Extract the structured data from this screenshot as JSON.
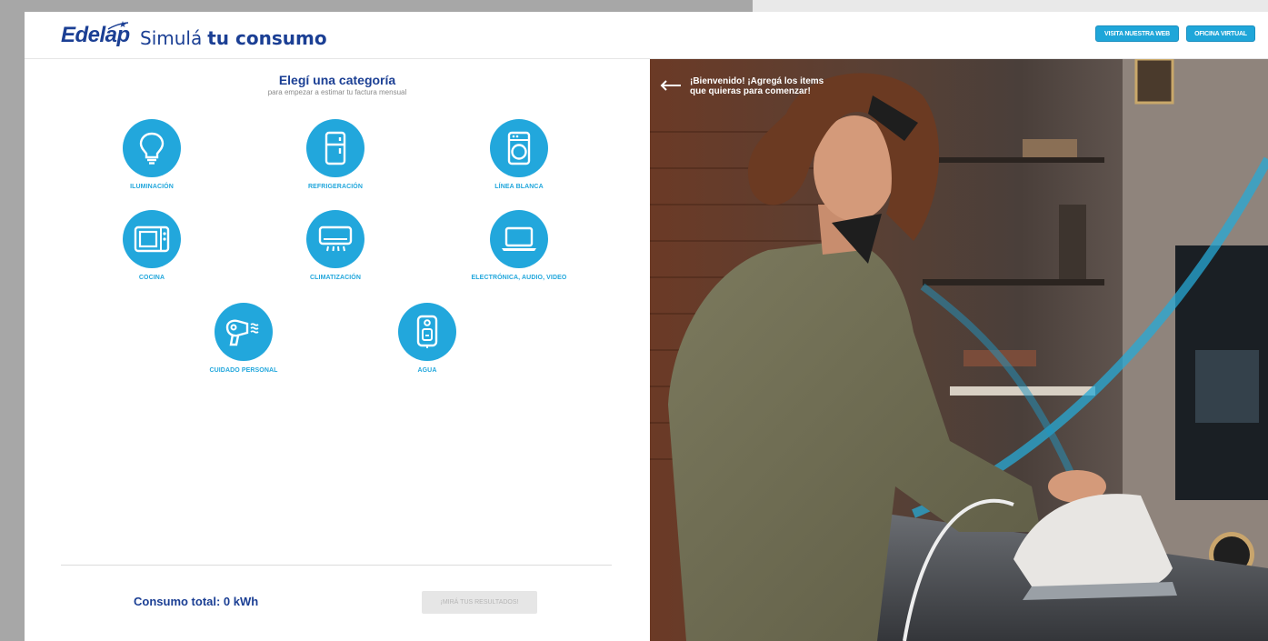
{
  "header": {
    "logo": "Edelap",
    "title_light": "Simulá",
    "title_bold": "tu consumo",
    "btn_web": "VISITA NUESTRA WEB",
    "btn_virtual": "OFICINA VIRTUAL"
  },
  "main": {
    "heading": "Elegí una categoría",
    "subheading": "para empezar a estimar tu factura mensual",
    "categories": [
      {
        "label": "ILUMINACIÓN",
        "icon": "lightbulb-icon"
      },
      {
        "label": "REFRIGERACIÓN",
        "icon": "fridge-icon"
      },
      {
        "label": "LÍNEA BLANCA",
        "icon": "washing-machine-icon"
      },
      {
        "label": "COCINA",
        "icon": "microwave-icon"
      },
      {
        "label": "CLIMATIZACIÓN",
        "icon": "air-conditioner-icon"
      },
      {
        "label": "ELECTRÓNICA, AUDIO, VIDEO",
        "icon": "laptop-icon"
      },
      {
        "label": "CUIDADO PERSONAL",
        "icon": "hairdryer-icon"
      },
      {
        "label": "AGUA",
        "icon": "water-heater-icon"
      }
    ],
    "total_label": "Consumo total: 0 kWh",
    "results_button": "¡MIRÁ TUS RESULTADOS!"
  },
  "photo": {
    "welcome_line1": "¡Bienvenido! ¡Agregá los items",
    "welcome_line2": "que quieras para comenzar!"
  },
  "colors": {
    "brand_dark": "#1b3f94",
    "accent": "#22a7dc"
  }
}
